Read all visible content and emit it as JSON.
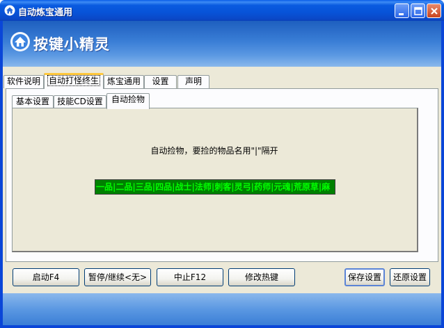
{
  "window": {
    "title": "自动炼宝通用",
    "icon": "home-icon"
  },
  "banner": {
    "logo_text": "按键小精灵",
    "icon": "home-logo-icon"
  },
  "outer_tabs": [
    {
      "label": "软件说明",
      "active": false
    },
    {
      "label": "自动打怪终生",
      "active": true
    },
    {
      "label": "炼宝通用",
      "active": false
    },
    {
      "label": "设置",
      "active": false
    },
    {
      "label": "声明",
      "active": false
    }
  ],
  "inner_tabs": [
    {
      "label": "基本设置",
      "active": false
    },
    {
      "label": "技能CD设置",
      "active": false
    },
    {
      "label": "自动捡物",
      "active": true
    }
  ],
  "pickup": {
    "hint": "自动捡物，要捡的物品名用\"|\"隔开",
    "items_value": "一品|二品|三品|四品|战士|法师|刺客|灵弓|药师|元魂|荒原草|麻"
  },
  "buttons": {
    "start": "启动F4",
    "pause": "暂停/继续<无>",
    "stop": "中止F12",
    "hotkey": "修改热键",
    "save": "保存设置",
    "restore": "还原设置"
  },
  "colors": {
    "titlebar": "#0753d8",
    "panel_bg": "#ece9d8",
    "field_bg": "#008000",
    "field_text": "#00ff00",
    "tab_highlight": "#ffc83c"
  }
}
